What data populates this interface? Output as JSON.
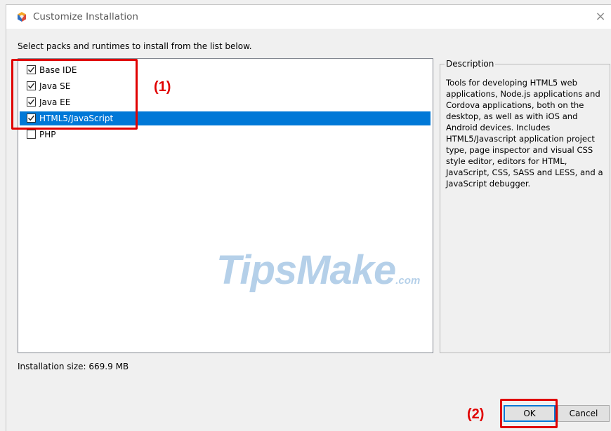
{
  "window": {
    "title": "Customize Installation",
    "close_glyph": "×"
  },
  "instruction": "Select packs and runtimes to install from the list below.",
  "packs": [
    {
      "label": "Base IDE",
      "checked": true,
      "selected": false
    },
    {
      "label": "Java SE",
      "checked": true,
      "selected": false
    },
    {
      "label": "Java EE",
      "checked": true,
      "selected": false
    },
    {
      "label": "HTML5/JavaScript",
      "checked": true,
      "selected": true
    },
    {
      "label": "PHP",
      "checked": false,
      "selected": false
    }
  ],
  "description": {
    "legend": "Description",
    "text": "Tools for developing HTML5 web applications, Node.js applications and Cordova applications, both on the desktop, as well as with iOS and Android devices. Includes HTML5/Javascript application project type, page inspector and visual CSS style editor, editors for HTML, JavaScript, CSS, SASS and LESS, and a JavaScript debugger."
  },
  "installation_size": "Installation size: 669.9 MB",
  "buttons": {
    "ok": "OK",
    "cancel": "Cancel"
  },
  "annotations": {
    "step1": "(1)",
    "step2": "(2)"
  },
  "watermark": {
    "main": "TipsMake",
    "suffix": ".com"
  },
  "colors": {
    "selection": "#0078d7",
    "annotation": "#e00000",
    "app_icon": [
      "#f5a623",
      "#2f6fbf",
      "#d94b3d"
    ]
  },
  "icons": {
    "app": "netbeans-cube-icon",
    "check": "checkmark-icon",
    "close": "close-icon"
  }
}
